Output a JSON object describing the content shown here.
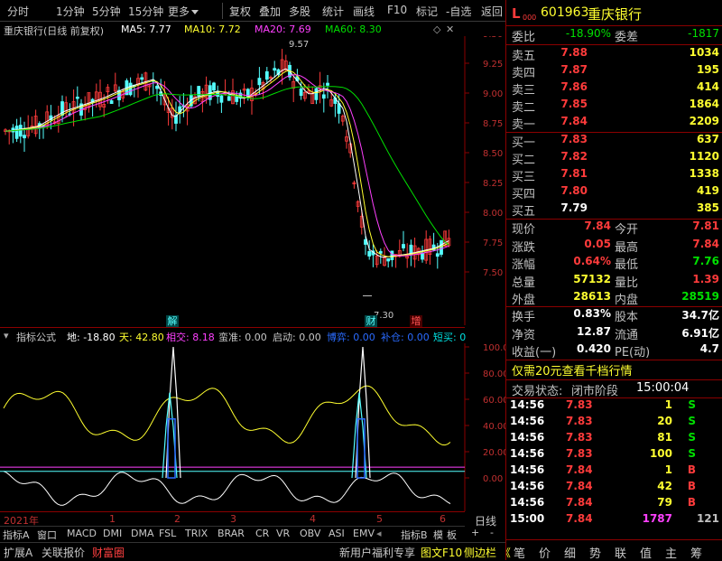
{
  "toolbar": {
    "items": [
      "分时",
      "1分钟",
      "5分钟",
      "15分钟",
      "更多",
      "复权",
      "叠加",
      "多股",
      "统计",
      "画线",
      "F10",
      "标记",
      "-自选",
      "返回"
    ]
  },
  "chart_header": {
    "stock_title": "重庆银行(日线 前复权)",
    "ma5": "MA5: 7.77",
    "ma10": "MA10: 7.72",
    "ma20": "MA20: 7.69",
    "ma60": "MA60: 8.30",
    "colors": {
      "ma5": "#ffffff",
      "ma10": "#ffff30",
      "ma20": "#ff40ff",
      "ma60": "#00e000"
    }
  },
  "price_axis": [
    "9.50",
    "9.25",
    "9.00",
    "8.75",
    "8.50",
    "8.25",
    "8.00",
    "7.75",
    "7.50"
  ],
  "price_annotations": {
    "high": "9.57",
    "low": "7.30"
  },
  "event_markers": [
    "解",
    "财",
    "增"
  ],
  "indicator_header": {
    "name": "指标公式",
    "di": "地: -18.80",
    "tian": "天: 42.80",
    "xiangjiao": "相交: 8.18",
    "jingzhun": "蛮准: 0.00",
    "qidong": "启动: 0.00",
    "zhuli": "博弈: 0.00",
    "bucang": "补仓: 0.00",
    "duanmai": "短买: 0"
  },
  "indicator_axis": [
    "100.0",
    "80.00",
    "60.00",
    "40.00",
    "20.00",
    "0.00"
  ],
  "time_axis": {
    "year": "2021年",
    "months": [
      "1",
      "2",
      "3",
      "4",
      "5",
      "6"
    ],
    "period": "日线"
  },
  "indicator_tabs": [
    "指标A",
    "窗口",
    "MACD",
    "DMI",
    "DMA",
    "FSL",
    "TRIX",
    "BRAR",
    "CR",
    "VR",
    "OBV",
    "ASI",
    "EMV",
    "指标B",
    "模",
    "板",
    "+",
    "-"
  ],
  "bottom_tabs": {
    "left": [
      "扩展A",
      "关联报价",
      "财富圈"
    ],
    "right": [
      "新用户福利专享",
      "图文F10",
      "侧边栏"
    ],
    "side": [
      "笔",
      "价",
      "细",
      "势",
      "联",
      "值",
      "主",
      "筹"
    ]
  },
  "quote": {
    "code": "601963",
    "name": "重庆银行",
    "flag": "L",
    "flag_sub": "000",
    "weibi_label": "委比",
    "weibi": "-18.90%",
    "weicha_label": "委差",
    "weicha": "-1817",
    "asks": [
      {
        "label": "卖五",
        "price": "7.88",
        "vol": "1034"
      },
      {
        "label": "卖四",
        "price": "7.87",
        "vol": "195"
      },
      {
        "label": "卖三",
        "price": "7.86",
        "vol": "414"
      },
      {
        "label": "卖二",
        "price": "7.85",
        "vol": "1864"
      },
      {
        "label": "卖一",
        "price": "7.84",
        "vol": "2209"
      }
    ],
    "bids": [
      {
        "label": "买一",
        "price": "7.83",
        "vol": "637"
      },
      {
        "label": "买二",
        "price": "7.82",
        "vol": "1120"
      },
      {
        "label": "买三",
        "price": "7.81",
        "vol": "1338"
      },
      {
        "label": "买四",
        "price": "7.80",
        "vol": "419"
      },
      {
        "label": "买五",
        "price": "7.79",
        "vol": "385"
      }
    ],
    "stats": [
      {
        "l1": "现价",
        "v1": "7.84",
        "l2": "今开",
        "v2": "7.81"
      },
      {
        "l1": "涨跌",
        "v1": "0.05",
        "l2": "最高",
        "v2": "7.84"
      },
      {
        "l1": "涨幅",
        "v1": "0.64%",
        "l2": "最低",
        "v2": "7.76"
      },
      {
        "l1": "总量",
        "v1": "57132",
        "l2": "量比",
        "v2": "1.39"
      },
      {
        "l1": "外盘",
        "v1": "28613",
        "l2": "内盘",
        "v2": "28519"
      }
    ],
    "stats2": [
      {
        "l1": "换手",
        "v1": "0.83%",
        "l2": "股本",
        "v2": "34.7亿"
      },
      {
        "l1": "净资",
        "v1": "12.87",
        "l2": "流通",
        "v2": "6.91亿"
      },
      {
        "l1": "收益(一)",
        "v1": "0.420",
        "l2": "PE(动)",
        "v2": "4.7"
      }
    ],
    "promo": "仅需20元查看千档行情",
    "trade_status_label": "交易状态:",
    "trade_status": "闭市阶段",
    "trade_time": "15:00:04",
    "ticks": [
      {
        "t": "14:56",
        "p": "7.83",
        "v": "1",
        "d": "S"
      },
      {
        "t": "14:56",
        "p": "7.83",
        "v": "20",
        "d": "S"
      },
      {
        "t": "14:56",
        "p": "7.83",
        "v": "81",
        "d": "S"
      },
      {
        "t": "14:56",
        "p": "7.83",
        "v": "100",
        "d": "S"
      },
      {
        "t": "14:56",
        "p": "7.84",
        "v": "1",
        "d": "B"
      },
      {
        "t": "14:56",
        "p": "7.84",
        "v": "42",
        "d": "B"
      },
      {
        "t": "14:56",
        "p": "7.84",
        "v": "79",
        "d": "B"
      },
      {
        "t": "15:00",
        "p": "7.84",
        "v": "1787",
        "d": "121"
      }
    ]
  }
}
